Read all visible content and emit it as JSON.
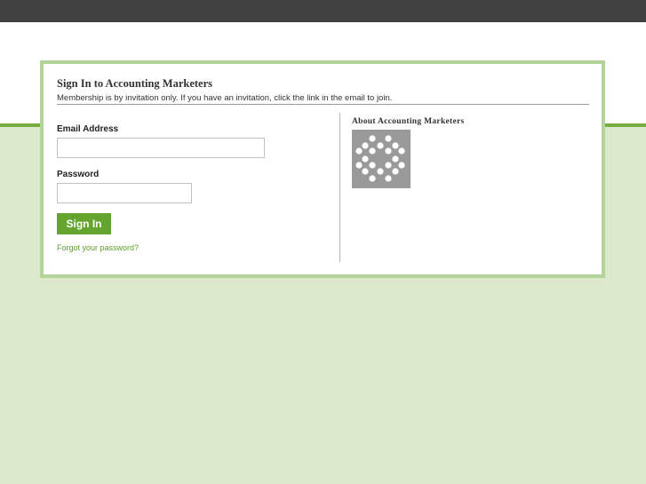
{
  "signin": {
    "title": "Sign In to Accounting Marketers",
    "subtitle": "Membership is by invitation only. If you have an invitation, click the link in the email to join.",
    "email_label": "Email Address",
    "email_value": "",
    "password_label": "Password",
    "password_value": "",
    "signin_label": "Sign In",
    "forgot_label": "Forgot your password?"
  },
  "about": {
    "title": "About Accounting Marketers",
    "logo_icon": "dot-pattern-logo-icon"
  },
  "colors": {
    "top_bar": "#414141",
    "accent_green": "#64a530",
    "card_border": "#b2d597",
    "page_background": "#dce9cd"
  }
}
